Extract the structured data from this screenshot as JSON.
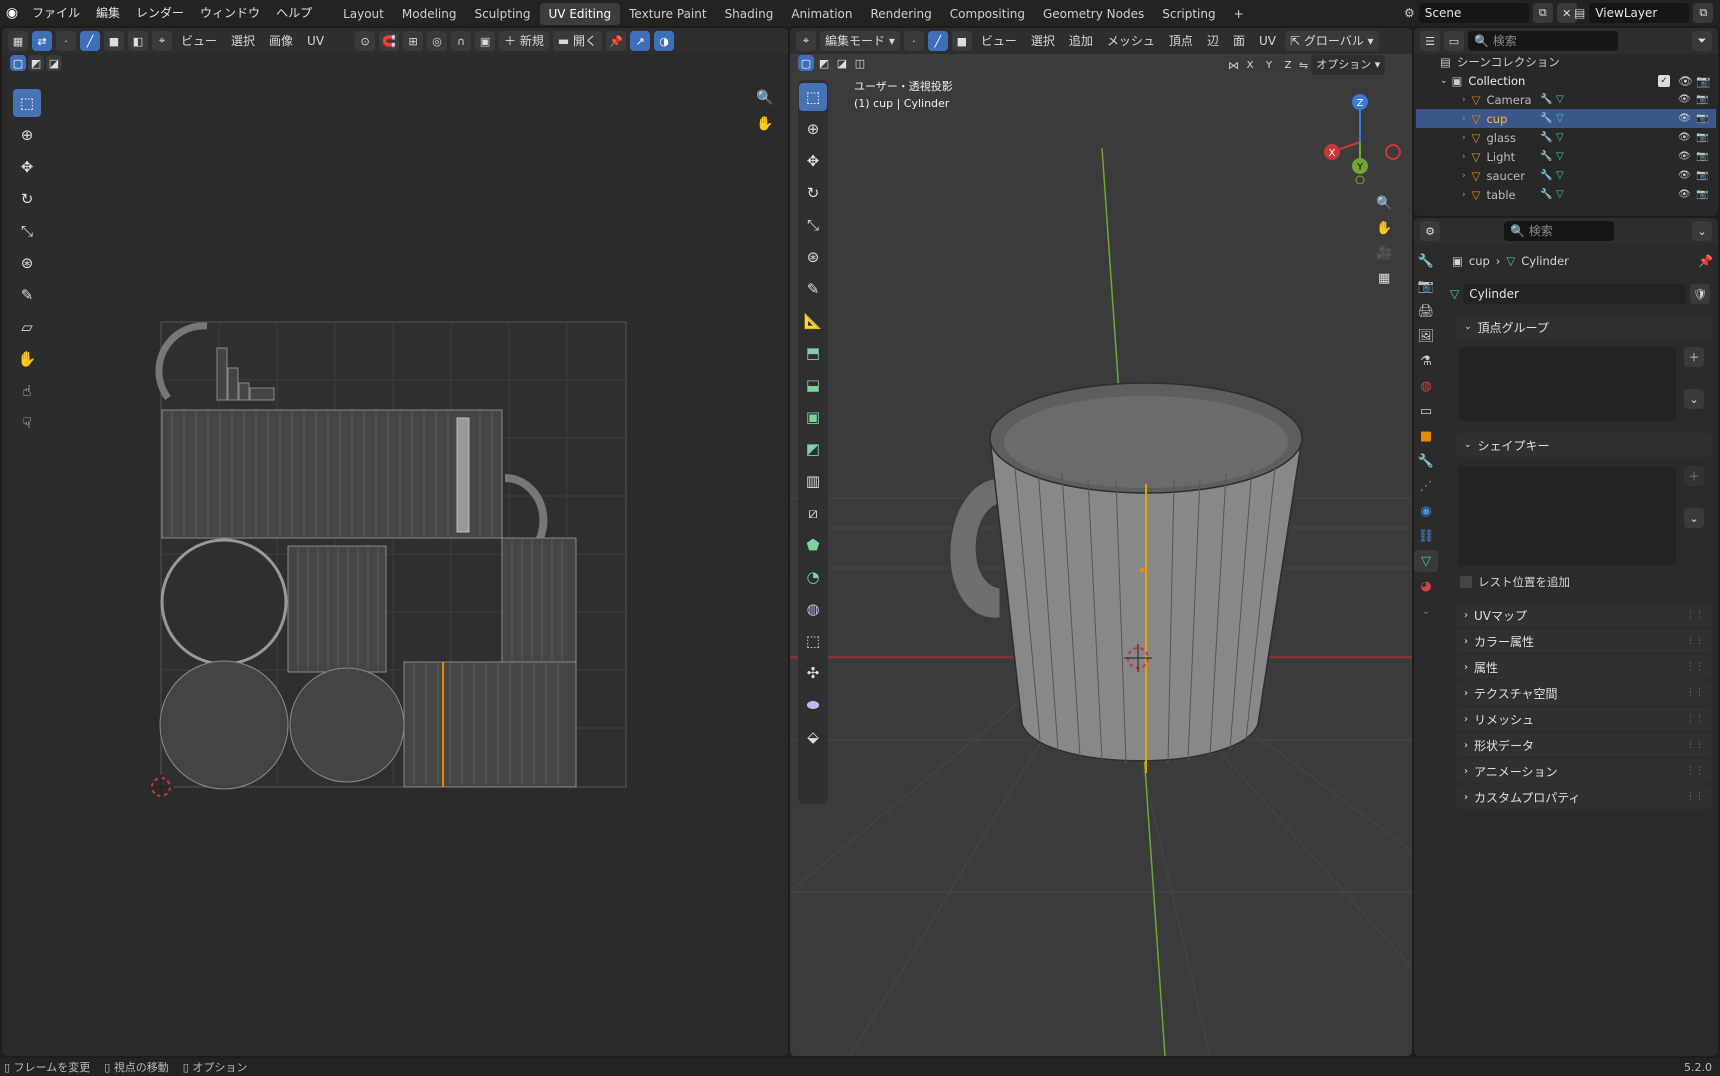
{
  "topbar": {
    "menus": [
      "ファイル",
      "編集",
      "レンダー",
      "ウィンドウ",
      "ヘルプ"
    ],
    "workspaces": [
      "Layout",
      "Modeling",
      "Sculpting",
      "UV Editing",
      "Texture Paint",
      "Shading",
      "Animation",
      "Rendering",
      "Compositing",
      "Geometry Nodes",
      "Scripting"
    ],
    "active_workspace": "UV Editing",
    "add_tab": "+",
    "scene": "Scene",
    "view_layer": "ViewLayer"
  },
  "uv_editor": {
    "header": {
      "view": "ビュー",
      "select": "選択",
      "image": "画像",
      "uv": "UV",
      "new": "新規",
      "open": "開く"
    },
    "tools": [
      "select-box-icon",
      "cursor-icon",
      "move-icon",
      "rotate-icon",
      "scale-icon",
      "transform-icon",
      "annotate-icon",
      "rip-icon",
      "grab-icon",
      "relax-icon",
      "pinch-icon"
    ]
  },
  "viewport": {
    "header": {
      "mode": "編集モード",
      "view": "ビュー",
      "select": "選択",
      "add": "追加",
      "mesh": "メッシュ",
      "vertex": "頂点",
      "edge": "辺",
      "face": "面",
      "uv": "UV",
      "orientation": "グローバル",
      "options": "オプション"
    },
    "overlay_title": "ユーザー・透視投影",
    "overlay_object": "(1) cup | Cylinder",
    "gizmo": {
      "x": "X",
      "y": "Y",
      "z": "Z"
    },
    "axis_lock": [
      "X",
      "Y",
      "Z"
    ]
  },
  "outliner": {
    "search_placeholder": "検索",
    "scene_collection": "シーンコレクション",
    "collection": "Collection",
    "items": [
      {
        "name": "Camera",
        "selected": false
      },
      {
        "name": "cup",
        "selected": true
      },
      {
        "name": "glass",
        "selected": false
      },
      {
        "name": "Light",
        "selected": false
      },
      {
        "name": "saucer",
        "selected": false
      },
      {
        "name": "table",
        "selected": false
      }
    ]
  },
  "properties": {
    "search_placeholder": "検索",
    "breadcrumb_object": "cup",
    "breadcrumb_data": "Cylinder",
    "mesh_name": "Cylinder",
    "vertex_groups": "頂点グループ",
    "shape_keys": "シェイプキー",
    "relative_label": "レスト位置を追加",
    "sections": [
      "UVマップ",
      "カラー属性",
      "属性",
      "テクスチャ空間",
      "リメッシュ",
      "形状データ",
      "アニメーション",
      "カスタムプロパティ"
    ]
  },
  "statusbar": {
    "items": [
      "フレームを変更",
      "視点の移動",
      "オプション"
    ],
    "version": "5.2.0"
  },
  "colors": {
    "accent": "#4772b3",
    "active_orange": "#e68a00",
    "axis_red": "#c8383a",
    "axis_green": "#6ea832",
    "axis_blue": "#3a7ad8",
    "mesh_green": "#45c9a3"
  }
}
